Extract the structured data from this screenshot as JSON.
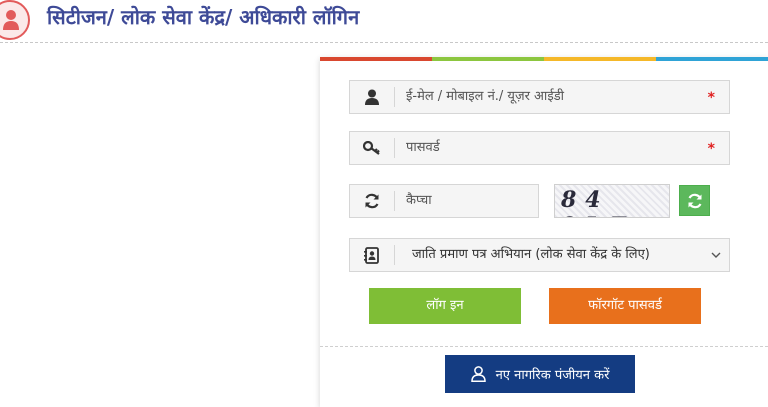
{
  "header": {
    "title": "सिटीजन/ लोक सेवा केंद्र/ अधिकारी लॉगिन"
  },
  "colors": {
    "stripes": [
      "#d9482f",
      "#8cc63f",
      "#f5b829",
      "#2fa3d6"
    ],
    "title": "#3e4a97",
    "login_button": "#7fbe36",
    "forgot_button": "#e8701c",
    "register_button": "#143c82",
    "refresh_button": "#5cb85c",
    "required_star": "#e02020"
  },
  "form": {
    "username": {
      "placeholder": "ई-मेल / मोबाइल नं./ यूज़र आईडी",
      "required_mark": "*",
      "icon": "user-icon"
    },
    "password": {
      "placeholder": "पासवर्ड",
      "required_mark": "*",
      "icon": "key-icon"
    },
    "captcha": {
      "placeholder": "कैप्चा",
      "image_text": "84 9LF",
      "icon": "refresh-icon"
    },
    "role_select": {
      "selected": "जाति प्रमाण पत्र अभियान (लोक सेवा केंद्र के लिए)",
      "icon": "contact-card-icon"
    },
    "login_label": "लॉग इन",
    "forgot_label": "फॉरगॉट पासवर्ड",
    "register_label": "नए नागरिक पंजीयन करें"
  }
}
